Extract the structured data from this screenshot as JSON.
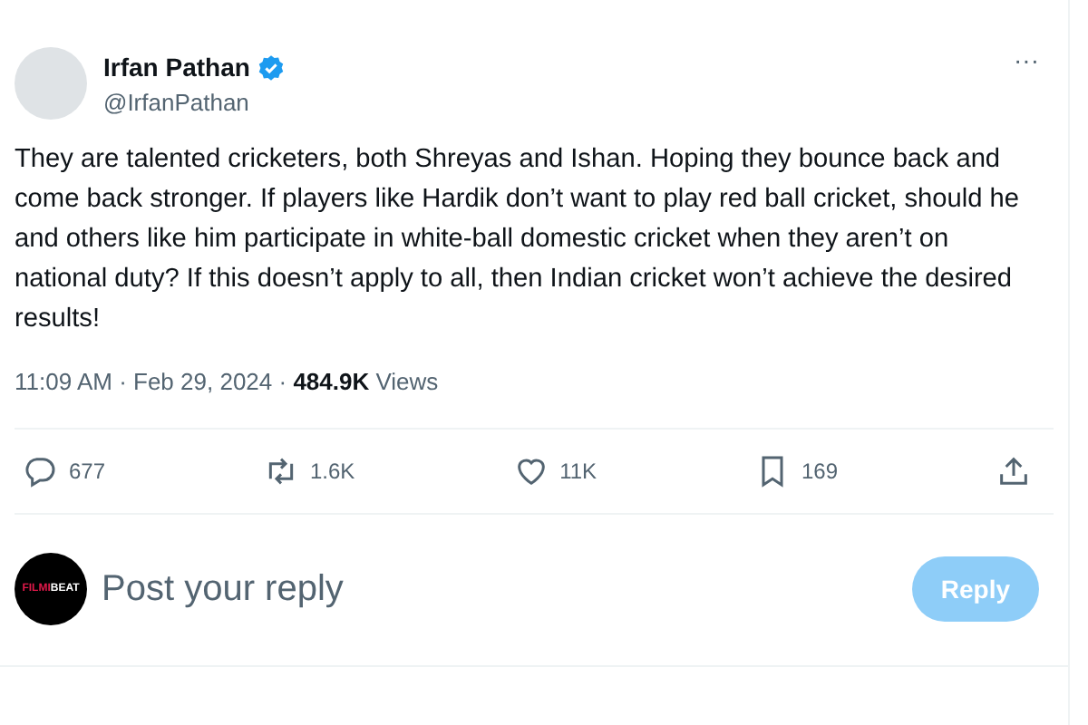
{
  "post": {
    "author": {
      "name": "Irfan Pathan",
      "verified": true,
      "handle": "@IrfanPathan"
    },
    "more": "···",
    "text": "They are talented cricketers, both Shreyas and Ishan. Hoping they bounce back and come back stronger. If players like Hardik don’t want to play red ball cricket, should he and others like him participate in white-ball domestic cricket when they aren’t on national duty? If this doesn’t apply to all, then Indian cricket won’t achieve the desired results!",
    "meta": "11:09 AM · Feb 29, 2024 · **484.9K** Views",
    "actions": [
      {
        "kind": "reply",
        "count": "677"
      },
      {
        "kind": "repost",
        "count": "1.6K"
      },
      {
        "kind": "like",
        "count": "11K"
      },
      {
        "kind": "bookmark",
        "count": "169"
      },
      {
        "kind": "share"
      }
    ]
  },
  "reply_box": {
    "logo": [
      "FILMI",
      "BEAT"
    ],
    "placeholder": "Post your reply",
    "button": {
      "label": "Reply",
      "disabled": true
    }
  }
}
